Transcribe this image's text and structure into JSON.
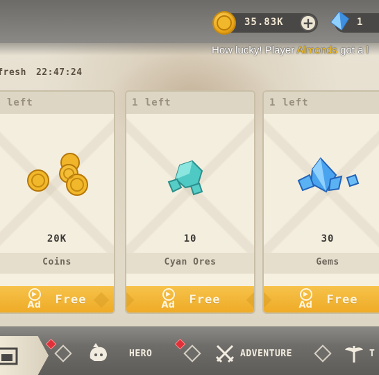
{
  "currency": {
    "coins": "35.83K",
    "gems": "1",
    "plus_icon": "plus-icon",
    "coin_icon": "coin-icon",
    "gem_icon": "gem-icon"
  },
  "ticker": {
    "prefix": "How lucky! Player ",
    "player": "Almonds",
    "suffix": " got a ",
    "truncated": "l"
  },
  "refresh": {
    "label": "efresh",
    "time": "22:47:24"
  },
  "cards": [
    {
      "left": "left",
      "quantity": "20K",
      "name": "Coins",
      "ad": "Ad",
      "action": "Free"
    },
    {
      "left": "1 left",
      "quantity": "10",
      "name": "Cyan Ores",
      "ad": "Ad",
      "action": "Free"
    },
    {
      "left": "1 left",
      "quantity": "30",
      "name": "Gems",
      "ad": "Ad",
      "action": "Free"
    }
  ],
  "nav": {
    "hero": "HERO",
    "adventure": "ADVENTURE",
    "truncated": "T"
  },
  "colors": {
    "accent": "#f6c24a",
    "ticker_highlight": "#ffc61a",
    "badge": "#e0303a"
  }
}
